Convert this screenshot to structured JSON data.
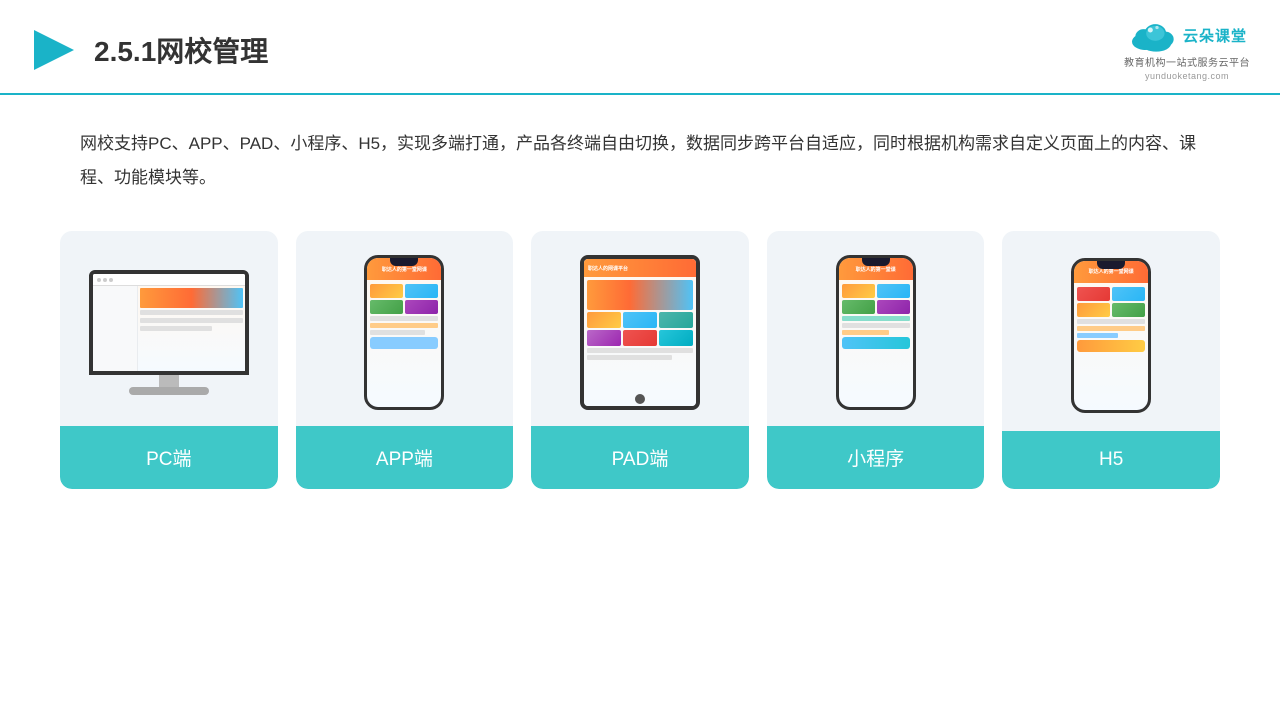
{
  "header": {
    "title": "2.5.1网校管理",
    "logo_name": "云朵课堂",
    "logo_url": "yunduoketang.com",
    "logo_slogan": "教育机构一站\n式服务云平台"
  },
  "description": "网校支持PC、APP、PAD、小程序、H5，实现多端打通，产品各终端自由切换，数据同步跨平台自适应，同时根据机构需求自定义页面上的内容、课程、功能模块等。",
  "cards": [
    {
      "label": "PC端",
      "type": "pc"
    },
    {
      "label": "APP端",
      "type": "phone"
    },
    {
      "label": "PAD端",
      "type": "tablet"
    },
    {
      "label": "小程序",
      "type": "phone"
    },
    {
      "label": "H5",
      "type": "phone"
    }
  ],
  "accent_color": "#3fc8c8"
}
